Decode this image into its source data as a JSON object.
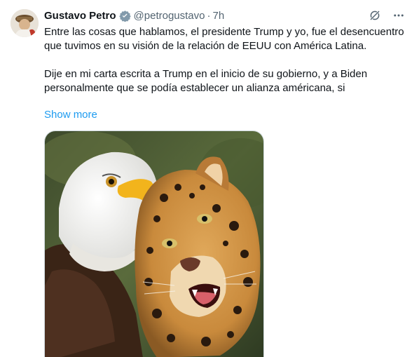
{
  "tweet": {
    "author_name": "Gustavo Petro",
    "handle": "@petrogustavo",
    "separator": "·",
    "time": "7h",
    "paragraph1": "Entre las cosas que hablamos, el presidente Trump y yo, fue el desencuentro que tuvimos en su visión de la relación de EEUU con América Latina.",
    "paragraph2": "Dije en mi carta escrita a Trump en el inicio de su gobierno, y a Biden personalmente que se podía establecer un alianza américana, si",
    "show_more": "Show more"
  },
  "icons": {
    "verified": "verified-badge-icon",
    "grok": "grok-icon",
    "more": "more-options-icon"
  },
  "colors": {
    "link": "#1d9bf0",
    "secondary_text": "#536471",
    "verified_badge": "#829aab"
  }
}
